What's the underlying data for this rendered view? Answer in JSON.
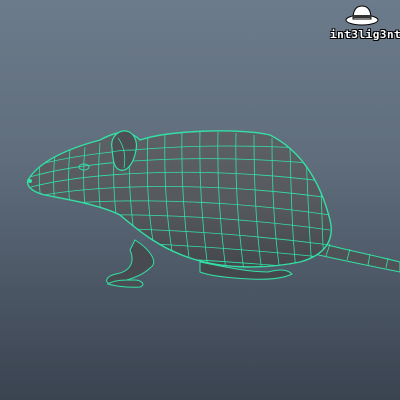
{
  "viewport": {
    "name": "3d-viewport"
  },
  "model": {
    "name": "rat-wireframe",
    "wire_color": "#33e0a5",
    "surface_color": "#565a5e"
  },
  "logo": {
    "text": "int3lig3nt",
    "icon": "fedora-hat-icon"
  }
}
